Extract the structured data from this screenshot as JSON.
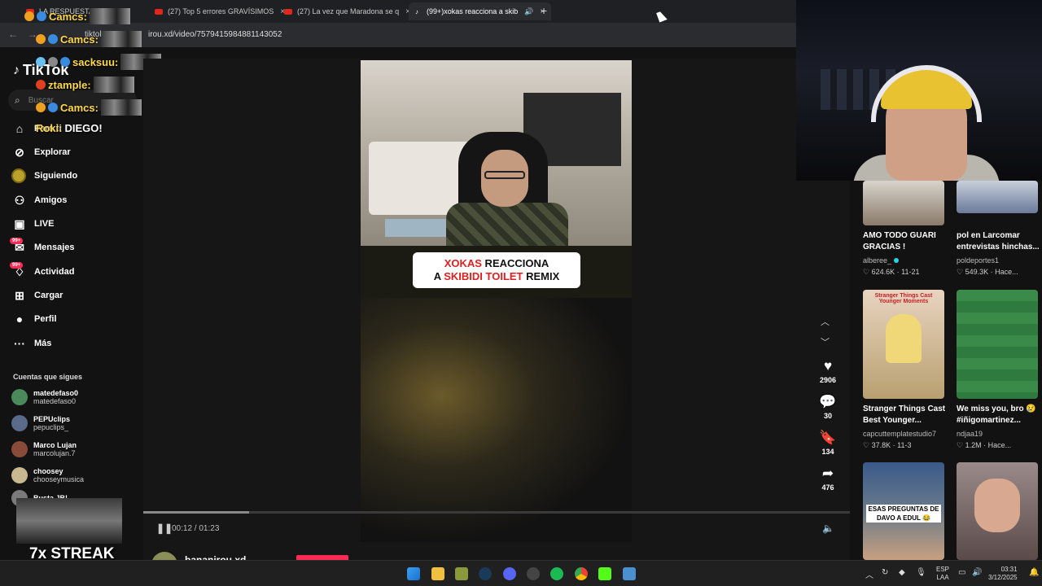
{
  "browser": {
    "tabs": [
      {
        "label": "LA RESPUESTA DE MA",
        "kind": "youtube"
      },
      {
        "label": "(27) Top 5 errores GRAVÍSIMOS",
        "kind": "youtube"
      },
      {
        "label": "(27) La vez que Maradona se q",
        "kind": "youtube"
      },
      {
        "label": "(99+)xokas reacciona a skib",
        "kind": "tiktok"
      }
    ],
    "new_tab": "+",
    "close": "×",
    "url": "irou.xd/video/7579415984881143052",
    "url_prefix": "tiktok"
  },
  "tiktok": {
    "logo": "TikTok",
    "search_placeholder": "Buscar",
    "nav": [
      {
        "label": "Para ti",
        "icon": "home-icon"
      },
      {
        "label": "Explorar",
        "icon": "compass-icon"
      },
      {
        "label": "Siguiendo",
        "icon": "following-icon"
      },
      {
        "label": "Amigos",
        "icon": "friends-icon"
      },
      {
        "label": "LIVE",
        "icon": "live-icon"
      },
      {
        "label": "Mensajes",
        "icon": "messages-icon",
        "badge": "99+"
      },
      {
        "label": "Actividad",
        "icon": "activity-icon",
        "badge": "99+"
      },
      {
        "label": "Cargar",
        "icon": "upload-icon"
      },
      {
        "label": "Perfil",
        "icon": "profile-icon"
      },
      {
        "label": "Más",
        "icon": "more-icon"
      }
    ],
    "following_title": "Cuentas que sigues",
    "following": [
      {
        "name": "matedefaso0",
        "handle": "matedefaso0",
        "color": "#4a8a5a"
      },
      {
        "name": "PEPUclips",
        "handle": "pepuclips_",
        "color": "#5a6a8a"
      },
      {
        "name": "Marco Lujan",
        "handle": "marcolujan.7",
        "color": "#8a4a3a"
      },
      {
        "name": "choosey",
        "handle": "chooseymusica",
        "color": "#c8b890"
      },
      {
        "name": "Busta JB!",
        "handle": "",
        "color": "#7a7a7a"
      }
    ],
    "video": {
      "caption_line1_red": "XOKAS",
      "caption_line1_rest": " REACCIONA",
      "caption_line2_pre": "A ",
      "caption_line2_red": "SKIBIDI TOILET",
      "caption_line2_rest": " REMIX",
      "time": "00:12 / 01:23",
      "progress": 0.15,
      "author": "bananirou.xd"
    },
    "actions": {
      "likes": "2906",
      "comments": "30",
      "saves": "134",
      "shares": "476"
    },
    "recommended": [
      {
        "title": "AMO TODO GUARI GRACIAS !",
        "user": "alberee_",
        "verified": true,
        "views": "624.6K",
        "date": "11-21",
        "colors": [
          "#d8d4cc",
          "#8a7a6a"
        ]
      },
      {
        "title": "pol en Larcomar entrevistas hinchas...",
        "user": "poldeportes1",
        "verified": false,
        "views": "549.3K",
        "date": "Hace...",
        "colors": [
          "#c8d0dc",
          "#6a7a9a"
        ]
      },
      {
        "title": "Stranger Things Cast Best Younger...",
        "user": "capcuttemplatestudio7",
        "verified": false,
        "views": "37.8K",
        "date": "11-3",
        "overlay": "Stranger Things Cast Younger Moments",
        "colors": [
          "#e8d4c0",
          "#b8a070"
        ]
      },
      {
        "title": "We miss you, bro 😢 #iñigomartinez...",
        "user": "ndjaa19",
        "verified": false,
        "views": "1.2M",
        "date": "Hace...",
        "colors": [
          "#3a8a4a",
          "#2a6a3a"
        ]
      },
      {
        "title": "",
        "user": "",
        "verified": false,
        "views": "",
        "date": "",
        "overlay": "ESAS PREGUNTAS DE DAVO A EDUL 😂",
        "colors": [
          "#3a5a8a",
          "#c8a080"
        ]
      },
      {
        "title": "",
        "user": "",
        "verified": false,
        "views": "",
        "date": "",
        "colors": [
          "#9a8a8a",
          "#5a4a4a"
        ]
      }
    ]
  },
  "overlay_chat": [
    {
      "name": "Camcs:",
      "text": ""
    },
    {
      "name": "Camcs:",
      "text": ""
    },
    {
      "name": "sacksuu:",
      "text": ""
    },
    {
      "name": "ztample:",
      "text": ""
    },
    {
      "name": "Camcs:",
      "text": ""
    },
    {
      "name": "Roki:",
      "text": "DIEGO!"
    }
  ],
  "streak": "7x STREAK",
  "taskbar": {
    "lang_top": "ESP",
    "lang_bottom": "LAA",
    "time": "03:31",
    "date": "3/12/2025"
  }
}
